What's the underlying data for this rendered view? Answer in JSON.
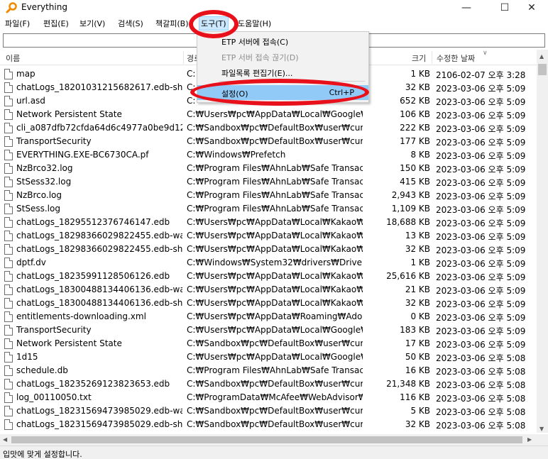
{
  "window": {
    "title": "Everything",
    "minimize_icon": "minimize-icon",
    "maximize_icon": "maximize-icon",
    "close_icon": "close-icon"
  },
  "menubar": [
    {
      "label": "파일(F)"
    },
    {
      "label": "편집(E)"
    },
    {
      "label": "보기(V)"
    },
    {
      "label": "검색(S)"
    },
    {
      "label": "책갈피(B)"
    },
    {
      "label": "도구(T)"
    },
    {
      "label": "도움말(H)"
    }
  ],
  "search": {
    "value": "",
    "placeholder": ""
  },
  "columns": {
    "name": "이름",
    "path": "경로",
    "size": "크기",
    "date": "수정한 날짜"
  },
  "tools_menu": {
    "items": [
      {
        "label": "ETP 서버에 접속(C)",
        "shortcut": "",
        "enabled": true
      },
      {
        "label": "ETP 서버 접속 끊기(D)",
        "shortcut": "",
        "enabled": false
      },
      {
        "label": "파일목록 편집기(E)...",
        "shortcut": "",
        "enabled": true
      },
      {
        "label": "설정(O)",
        "shortcut": "Ctrl+P",
        "enabled": true,
        "highlighted": true
      }
    ]
  },
  "rows": [
    {
      "name": "map",
      "path": "C:",
      "size": "1 KB",
      "date": "2106-02-07 오후 3:28"
    },
    {
      "name": "chatLogs_18201031215682617.edb-shm",
      "path": "C:",
      "size": "32 KB",
      "date": "2023-03-06 오후 5:09"
    },
    {
      "name": "url.asd",
      "path": "C:",
      "size": "652 KB",
      "date": "2023-03-06 오후 5:09"
    },
    {
      "name": "Network Persistent State",
      "path": "C:₩Users₩pc₩AppData₩Local₩Google₩Chr...",
      "size": "106 KB",
      "date": "2023-03-06 오후 5:09"
    },
    {
      "name": "cli_a087dfb72cfda64d6c4977a0be9d127...",
      "path": "C:₩Sandbox₩pc₩DefaultBox₩user₩current...",
      "size": "222 KB",
      "date": "2023-03-06 오후 5:09"
    },
    {
      "name": "TransportSecurity",
      "path": "C:₩Sandbox₩pc₩DefaultBox₩user₩current...",
      "size": "177 KB",
      "date": "2023-03-06 오후 5:09"
    },
    {
      "name": "EVERYTHING.EXE-BC6730CA.pf",
      "path": "C:₩Windows₩Prefetch",
      "size": "8 KB",
      "date": "2023-03-06 오후 5:09"
    },
    {
      "name": "NzBrco32.log",
      "path": "C:₩Program Files₩AhnLab₩Safe Transactio...",
      "size": "150 KB",
      "date": "2023-03-06 오후 5:09"
    },
    {
      "name": "StSess32.log",
      "path": "C:₩Program Files₩AhnLab₩Safe Transactio...",
      "size": "415 KB",
      "date": "2023-03-06 오후 5:09"
    },
    {
      "name": "NzBrco.log",
      "path": "C:₩Program Files₩AhnLab₩Safe Transactio...",
      "size": "2,943 KB",
      "date": "2023-03-06 오후 5:09"
    },
    {
      "name": "StSess.log",
      "path": "C:₩Program Files₩AhnLab₩Safe Transactio...",
      "size": "1,109 KB",
      "date": "2023-03-06 오후 5:09"
    },
    {
      "name": "chatLogs_18295512376746147.edb",
      "path": "C:₩Users₩pc₩AppData₩Local₩Kakao₩Kaka...",
      "size": "18,688 KB",
      "date": "2023-03-06 오후 5:09"
    },
    {
      "name": "chatLogs_18298366029822455.edb-wal",
      "path": "C:₩Users₩pc₩AppData₩Local₩Kakao₩Kaka...",
      "size": "13 KB",
      "date": "2023-03-06 오후 5:09"
    },
    {
      "name": "chatLogs_18298366029822455.edb-shm",
      "path": "C:₩Users₩pc₩AppData₩Local₩Kakao₩Kaka...",
      "size": "32 KB",
      "date": "2023-03-06 오후 5:09"
    },
    {
      "name": "dptf.dv",
      "path": "C:₩Windows₩System32₩drivers₩DriverDat...",
      "size": "1 KB",
      "date": "2023-03-06 오후 5:09"
    },
    {
      "name": "chatLogs_18235991128506126.edb",
      "path": "C:₩Users₩pc₩AppData₩Local₩Kakao₩Kaka...",
      "size": "25,616 KB",
      "date": "2023-03-06 오후 5:09"
    },
    {
      "name": "chatLogs_18300488134406136.edb-wal",
      "path": "C:₩Users₩pc₩AppData₩Local₩Kakao₩Kaka...",
      "size": "21 KB",
      "date": "2023-03-06 오후 5:09"
    },
    {
      "name": "chatLogs_18300488134406136.edb-shm",
      "path": "C:₩Users₩pc₩AppData₩Local₩Kakao₩Kaka...",
      "size": "32 KB",
      "date": "2023-03-06 오후 5:09"
    },
    {
      "name": "entitlements-downloading.xml",
      "path": "C:₩Users₩pc₩AppData₩Roaming₩Adobe₩...",
      "size": "0 KB",
      "date": "2023-03-06 오후 5:09"
    },
    {
      "name": "TransportSecurity",
      "path": "C:₩Users₩pc₩AppData₩Local₩Google₩Chr...",
      "size": "183 KB",
      "date": "2023-03-06 오후 5:09"
    },
    {
      "name": "Network Persistent State",
      "path": "C:₩Sandbox₩pc₩DefaultBox₩user₩current...",
      "size": "17 KB",
      "date": "2023-03-06 오후 5:09"
    },
    {
      "name": "1d15",
      "path": "C:₩Users₩pc₩AppData₩Local₩Google₩Chr...",
      "size": "50 KB",
      "date": "2023-03-06 오후 5:08"
    },
    {
      "name": "schedule.db",
      "path": "C:₩Program Files₩AhnLab₩Safe Transactio...",
      "size": "16 KB",
      "date": "2023-03-06 오후 5:08"
    },
    {
      "name": "chatLogs_18235269123823653.edb",
      "path": "C:₩Sandbox₩pc₩DefaultBox₩user₩current...",
      "size": "21,348 KB",
      "date": "2023-03-06 오후 5:08"
    },
    {
      "name": "log_00110050.txt",
      "path": "C:₩ProgramData₩McAfee₩WebAdvisor₩Lo...",
      "size": "116 KB",
      "date": "2023-03-06 오후 5:08"
    },
    {
      "name": "chatLogs_18231569473985029.edb-wal",
      "path": "C:₩Sandbox₩pc₩DefaultBox₩user₩current...",
      "size": "5 KB",
      "date": "2023-03-06 오후 5:08"
    },
    {
      "name": "chatLogs_18231569473985029.edb-shm",
      "path": "C:₩Sandbox₩pc₩DefaultBox₩user₩current...",
      "size": "32 KB",
      "date": "2023-03-06 오후 5:08"
    }
  ],
  "status": {
    "text": "입맛에 맞게 설정합니다."
  },
  "annotation_color": "#e8101a"
}
